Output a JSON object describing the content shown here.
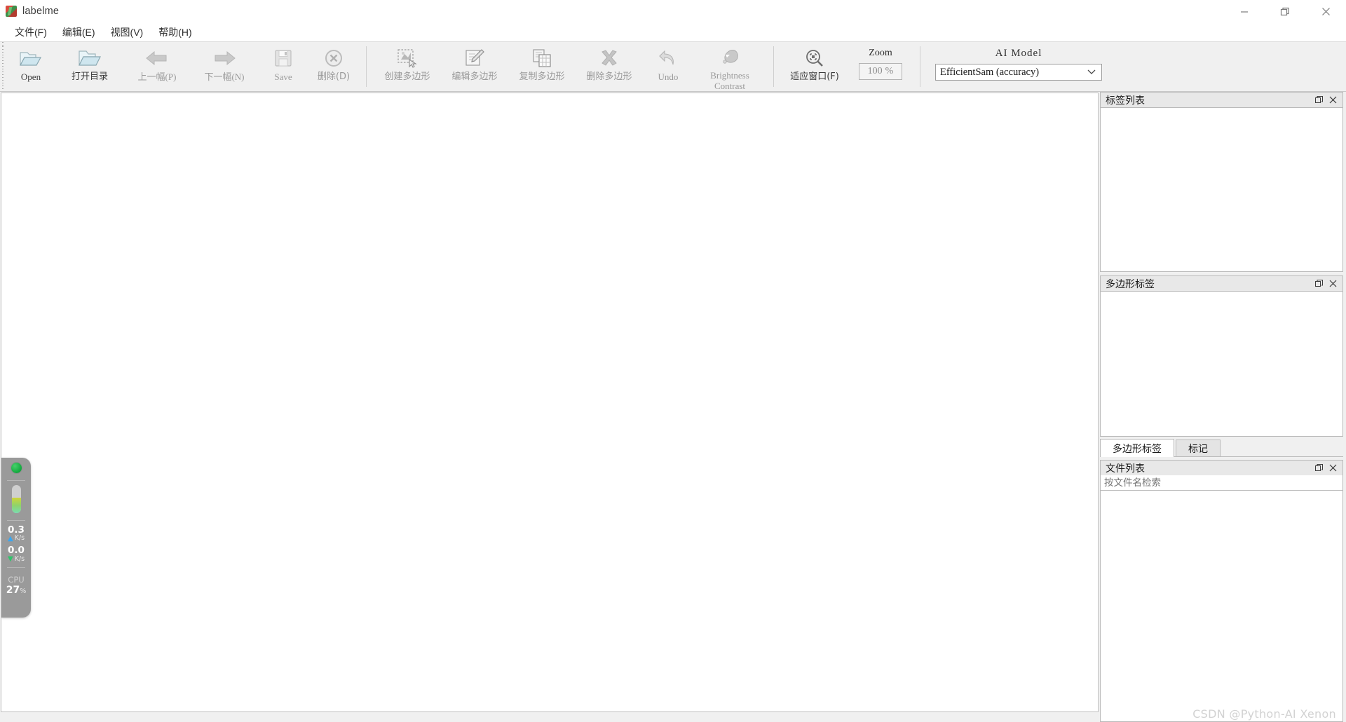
{
  "window": {
    "title": "labelme",
    "icon": "labelme-app-icon",
    "controls": [
      {
        "name": "minimize",
        "glyph": "minimize-icon"
      },
      {
        "name": "maximize",
        "glyph": "maximize-icon"
      },
      {
        "name": "close",
        "glyph": "close-icon"
      }
    ]
  },
  "menubar": {
    "items": [
      {
        "label": "文件(F)",
        "name": "menu-file"
      },
      {
        "label": "编辑(E)",
        "name": "menu-edit"
      },
      {
        "label": "视图(V)",
        "name": "menu-view"
      },
      {
        "label": "帮助(H)",
        "name": "menu-help"
      }
    ]
  },
  "toolbar": {
    "open_label": "Open",
    "open_dir_label": "打开目录",
    "prev_label": "上一幅(P)",
    "next_label": "下一幅(N)",
    "save_label": "Save",
    "delete_label": "删除(D)",
    "create_polygon_label": "创建多边形",
    "edit_polygon_label": "编辑多边形",
    "duplicate_polygon_label": "复制多边形",
    "delete_polygon_label": "删除多边形",
    "undo_label": "Undo",
    "brightness_label": "Brightness",
    "contrast_label": "Contrast",
    "fit_window_label": "适应窗口(F)",
    "zoom_label": "Zoom",
    "zoom_value": "100",
    "zoom_unit": "%",
    "ai_model_label": "AI Model",
    "ai_model_value": "EfficientSam (accuracy)"
  },
  "dock": {
    "label_list": {
      "title": "标签列表",
      "items": []
    },
    "polygon_labels": {
      "title": "多边形标签",
      "items": []
    },
    "tabs": [
      {
        "label": "多边形标签",
        "active": true
      },
      {
        "label": "标记",
        "active": false
      }
    ],
    "file_list": {
      "title": "文件列表",
      "search_placeholder": "按文件名检索",
      "search_value": "",
      "items": []
    },
    "float_icon": "restore-dock-icon",
    "close_icon": "close-dock-icon"
  },
  "perf_widget": {
    "status_dot_color": "#12a93e",
    "memory_fill_pct": 56,
    "upload_value": "0.3",
    "upload_unit": "K/s",
    "download_value": "0.0",
    "download_unit": "K/s",
    "cpu_label": "CPU",
    "cpu_value": "27",
    "cpu_unit": "%"
  },
  "watermark": {
    "text": "CSDN @Python-AI Xenon"
  }
}
